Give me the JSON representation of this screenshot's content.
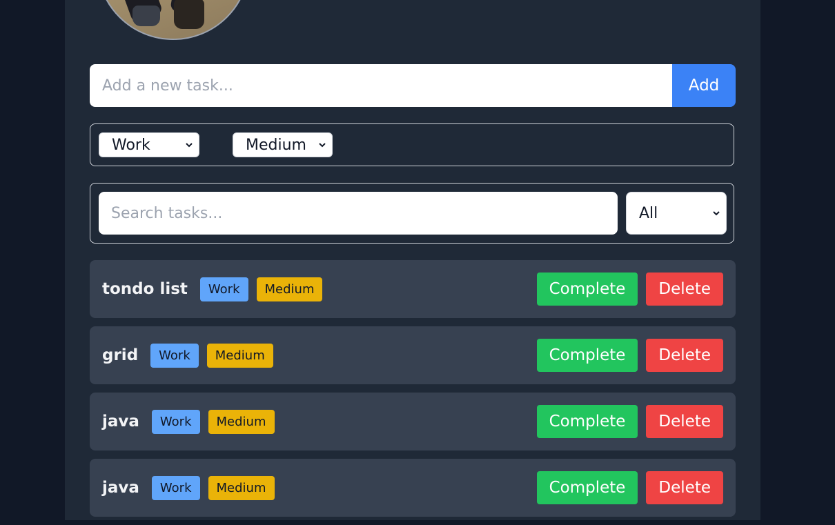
{
  "add_form": {
    "placeholder": "Add a new task...",
    "button_label": "Add"
  },
  "new_task_options": {
    "category": "Work",
    "priority": "Medium"
  },
  "search": {
    "placeholder": "Search tasks...",
    "filter": "All"
  },
  "tasks": [
    {
      "title": "tondo list",
      "category": "Work",
      "priority": "Medium",
      "complete_label": "Complete",
      "delete_label": "Delete"
    },
    {
      "title": "grid",
      "category": "Work",
      "priority": "Medium",
      "complete_label": "Complete",
      "delete_label": "Delete"
    },
    {
      "title": "java",
      "category": "Work",
      "priority": "Medium",
      "complete_label": "Complete",
      "delete_label": "Delete"
    },
    {
      "title": "java",
      "category": "Work",
      "priority": "Medium",
      "complete_label": "Complete",
      "delete_label": "Delete"
    }
  ],
  "colors": {
    "accent": "#3b82f6",
    "complete": "#22c55e",
    "delete": "#ef4444",
    "category_tag": "#60a5fa",
    "priority_tag": "#eab308"
  },
  "icons": {
    "select_arrow": "chevron-down-icon"
  }
}
